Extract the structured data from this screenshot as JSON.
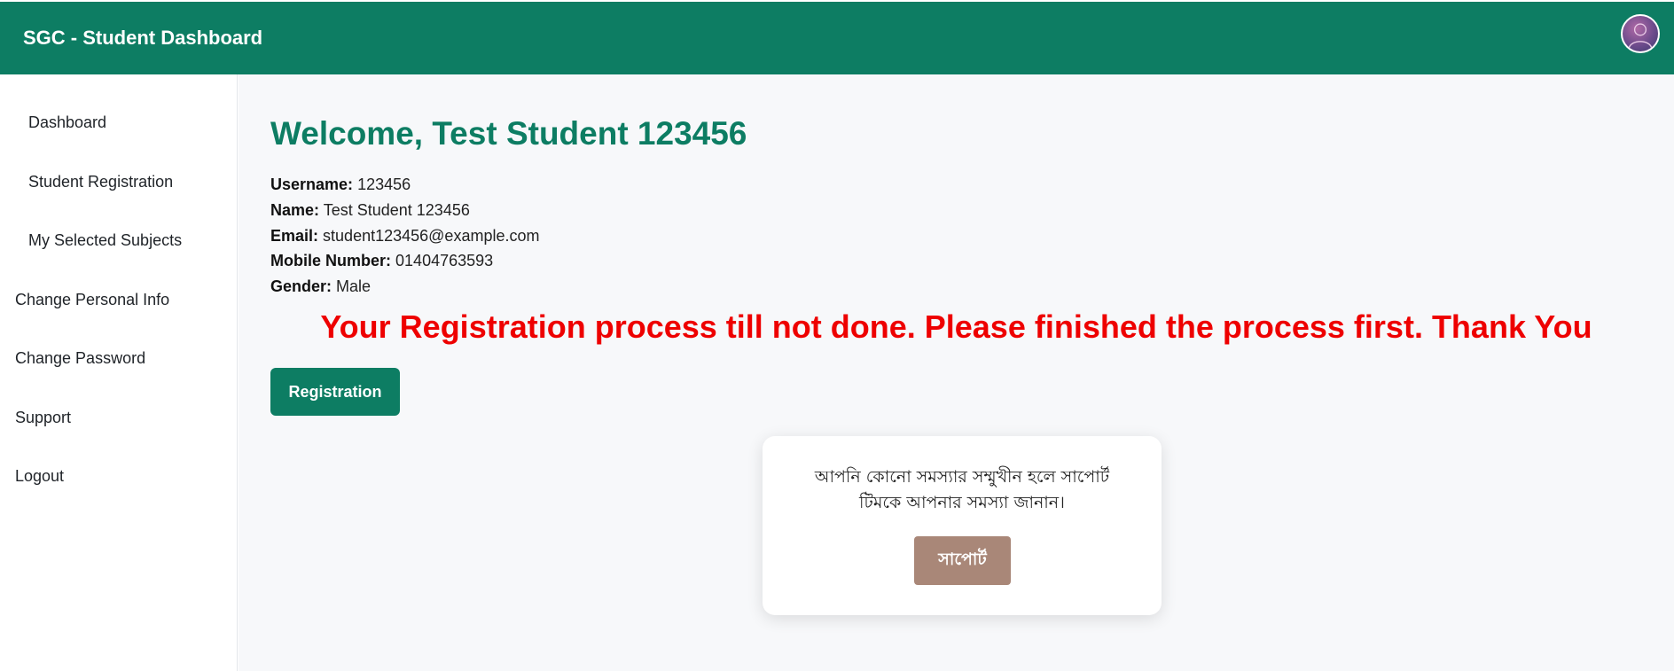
{
  "header": {
    "title": "SGC - Student Dashboard",
    "avatar_icon": "user-avatar-icon"
  },
  "sidebar": {
    "items": [
      {
        "label": "Dashboard"
      },
      {
        "label": "Student Registration"
      },
      {
        "label": "My Selected Subjects"
      },
      {
        "label": "Change Personal Info"
      },
      {
        "label": "Change Password"
      },
      {
        "label": "Support"
      },
      {
        "label": "Logout"
      }
    ]
  },
  "main": {
    "welcome": "Welcome, Test Student 123456",
    "profile": [
      {
        "label": "Username:",
        "value": "123456"
      },
      {
        "label": "Name:",
        "value": "Test Student 123456"
      },
      {
        "label": "Email:",
        "value": "student123456@example.com"
      },
      {
        "label": "Mobile Number:",
        "value": "01404763593"
      },
      {
        "label": "Gender:",
        "value": "Male"
      }
    ],
    "warning": "Your Registration process till not done. Please finished the process first. Thank You",
    "registration_button": "Registration"
  },
  "support_card": {
    "line1": "আপনি কোনো সমস্যার সম্মুখীন হলে সাপোর্ট",
    "line2": "টিমকে আপনার সমস্যা জানান।",
    "button": "সাপোর্ট"
  },
  "colors": {
    "brand": "#0d7d63",
    "warning": "#ee0000",
    "support_button": "#a98778"
  }
}
